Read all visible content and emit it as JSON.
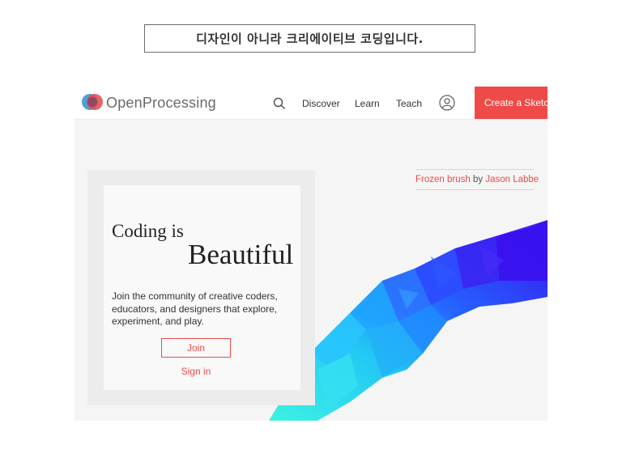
{
  "caption": {
    "text": "디자인이 아니라 크리에이티브 코딩입니다."
  },
  "header": {
    "brand": "OpenProcessing",
    "nav": {
      "discover": "Discover",
      "learn": "Learn",
      "teach": "Teach"
    },
    "cta_label": "Create a Sketch",
    "icons": [
      "search-icon",
      "user-icon",
      "logo-icon"
    ]
  },
  "credit": {
    "work": "Frozen brush",
    "by": "by",
    "author": "Jason Labbe"
  },
  "hero": {
    "line1": "Coding is",
    "line2": "Beautiful",
    "blurb": "Join the community of creative coders, educators, and designers that explore, experiment, and play.",
    "join_label": "Join",
    "signin_label": "Sign in"
  },
  "colors": {
    "accent": "#ee4a48",
    "cyan": "#32e6ee",
    "blue": "#2a3bff",
    "violet": "#3a10ee"
  }
}
